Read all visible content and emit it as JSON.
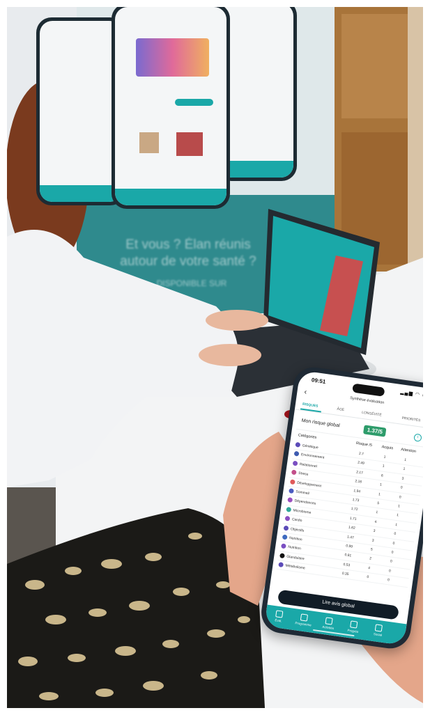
{
  "banner": {
    "line1": "Et vous ? Élan réunis",
    "line2": "autour de votre santé ?",
    "line3": "DISPONIBLE SUR"
  },
  "app": {
    "time": "09:51",
    "title": "Synthèse évaluation",
    "tabs": [
      "RISQUES",
      "ÂGE",
      "LONGÉVITÉ",
      "PRIORITÉS"
    ],
    "global_risk_label": "Mon risque global",
    "global_risk_value": "1.37/5",
    "columns": {
      "category": "Catégories",
      "risk": "Risque /5",
      "acquis": "Acquis",
      "attention": "Attention"
    },
    "rows": [
      {
        "name": "Génétique",
        "score": "2.7",
        "acquis": "1",
        "attention": "1",
        "color": "#5b4bb8"
      },
      {
        "name": "Environnement",
        "score": "2.49",
        "acquis": "1",
        "attention": "1",
        "color": "#3e5bb0"
      },
      {
        "name": "Relationnel",
        "score": "2.17",
        "acquis": "6",
        "attention": "3",
        "color": "#7a4fc2"
      },
      {
        "name": "Stress",
        "score": "2.16",
        "acquis": "1",
        "attention": "0",
        "color": "#c24f8a"
      },
      {
        "name": "Développement",
        "score": "1.94",
        "acquis": "1",
        "attention": "0",
        "color": "#e05a5a"
      },
      {
        "name": "Sommeil",
        "score": "1.73",
        "acquis": "5",
        "attention": "1",
        "color": "#4a5ac0"
      },
      {
        "name": "Dépendances",
        "score": "1.72",
        "acquis": "1",
        "attention": "1",
        "color": "#9a4fc0"
      },
      {
        "name": "Microbiome",
        "score": "1.71",
        "acquis": "4",
        "attention": "1",
        "color": "#2fa89a"
      },
      {
        "name": "Cardio",
        "score": "1.62",
        "acquis": "3",
        "attention": "0",
        "color": "#8a4fc2"
      },
      {
        "name": "Objectifs",
        "score": "1.47",
        "acquis": "3",
        "attention": "0",
        "color": "#5b4bb8"
      },
      {
        "name": "Nutrition",
        "score": "0.99",
        "acquis": "5",
        "attention": "0",
        "color": "#3e6bc0"
      },
      {
        "name": "Nutrition",
        "score": "0.81",
        "acquis": "2",
        "attention": "0",
        "color": "#7a4fc2"
      },
      {
        "name": "Glandulaire",
        "score": "0.53",
        "acquis": "4",
        "attention": "0",
        "color": "#111111"
      },
      {
        "name": "Métabolisme",
        "score": "0.35",
        "acquis": "0",
        "attention": "0",
        "color": "#5b4bb8"
      }
    ],
    "cta": "Lire avis global",
    "nav": [
      "Éval.",
      "Programme",
      "Activités",
      "Progrès",
      "Social"
    ]
  },
  "colors": {
    "teal": "#1aa8a8",
    "green_badge": "#2e9c6b",
    "banner": "#2f8a8d"
  }
}
